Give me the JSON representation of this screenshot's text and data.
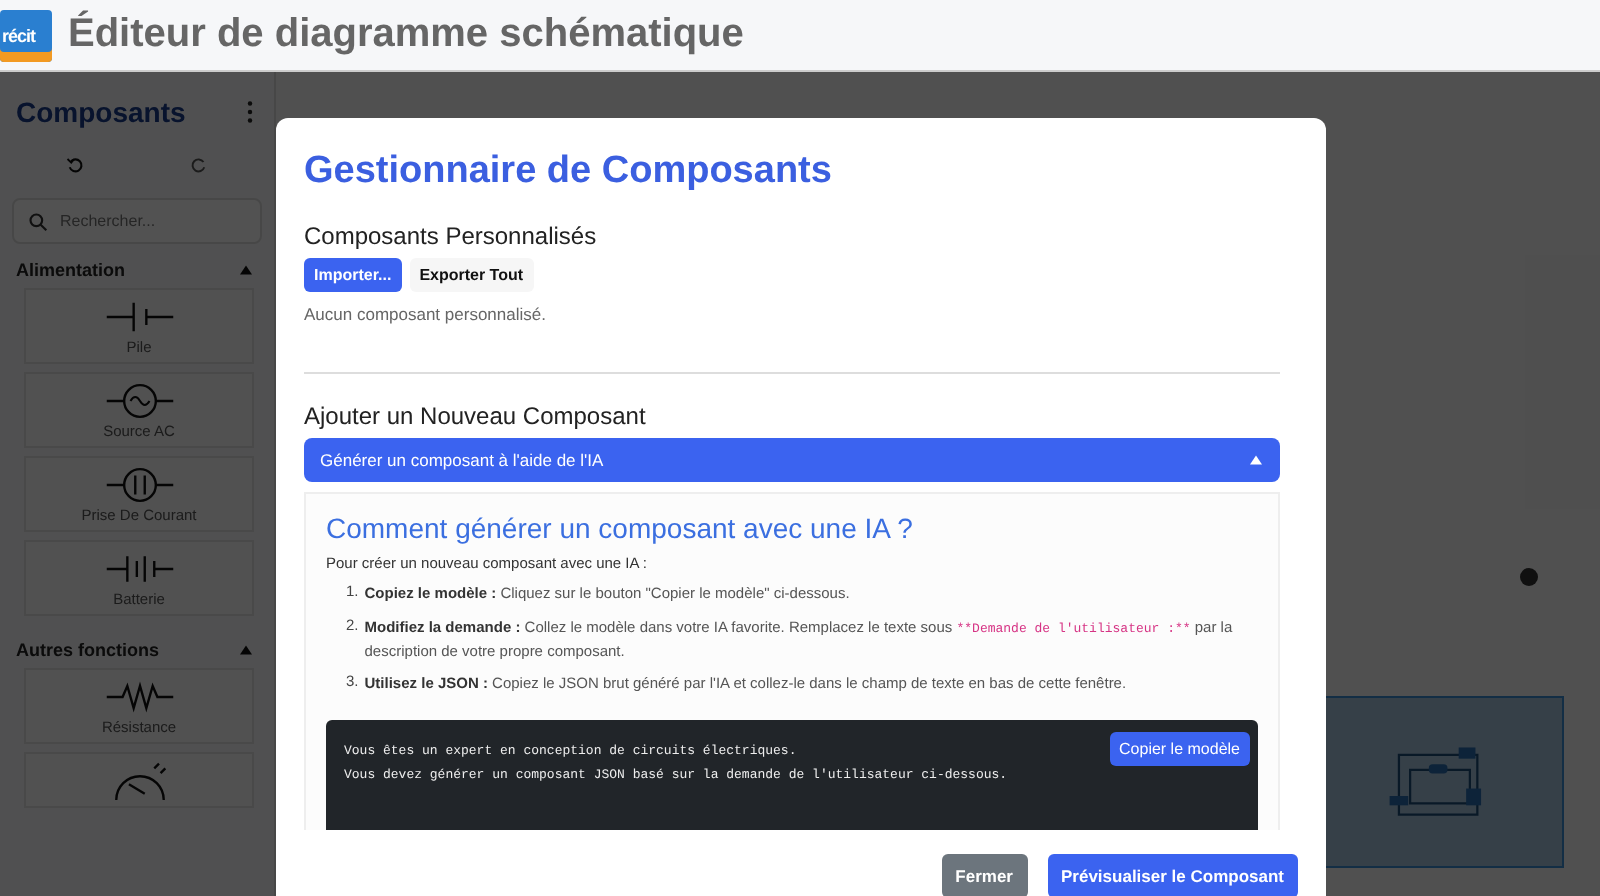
{
  "app": {
    "logo": "récit",
    "title": "Éditeur de diagramme schématique"
  },
  "sidebar": {
    "title": "Composants",
    "search": {
      "placeholder": "Rechercher..."
    },
    "sections": [
      {
        "title": "Alimentation",
        "expanded": true,
        "items": [
          {
            "kind": "cell",
            "label": "Pile"
          },
          {
            "kind": "ac-source",
            "label": "Source AC"
          },
          {
            "kind": "outlet",
            "label": "Prise De Courant"
          },
          {
            "kind": "battery",
            "label": "Batterie"
          }
        ]
      },
      {
        "title": "Autres fonctions",
        "expanded": true,
        "items": [
          {
            "kind": "resistor",
            "label": "Résistance"
          },
          {
            "kind": "meter"
          }
        ]
      }
    ]
  },
  "modal": {
    "title": "Gestionnaire de Composants",
    "custom": {
      "heading": "Composants Personnalisés",
      "buttons": [
        {
          "label": "Importer...",
          "kind": "primary"
        },
        {
          "label": "Exporter Tout",
          "kind": "light"
        }
      ],
      "empty": "Aucun composant personnalisé."
    },
    "add": {
      "heading": "Ajouter un Nouveau Composant",
      "accordion": {
        "label": "Générer un composant à l'aide de l'IA",
        "expanded": true
      },
      "help": {
        "heading": "Comment générer un composant avec une IA ?",
        "intro": "Pour créer un nouveau composant avec une IA :",
        "steps": [
          {
            "number": "1.",
            "lead": "Copiez le modèle :",
            "text": "Cliquez sur le bouton \"Copier le modèle\" ci-dessous."
          },
          {
            "number": "2.",
            "lead": "Modifiez la demande :",
            "text": "Collez le modèle dans votre IA favorite. Remplacez le texte sous",
            "code": "**Demande de l'utilisateur :**",
            "after": "par la description de votre propre composant."
          },
          {
            "number": "3.",
            "lead": "Utilisez le JSON :",
            "text": "Copiez le JSON brut généré par l'IA et collez-le dans le champ de texte en bas de cette fenêtre."
          }
        ],
        "template": {
          "lines": [
            "Vous êtes un expert en conception de circuits électriques.",
            "Vous devez générer un composant JSON basé sur la demande de l'utilisateur ci-dessous."
          ],
          "copy_button": "Copier le modèle"
        }
      }
    },
    "footer": [
      {
        "label": "Fermer",
        "kind": "secondary"
      },
      {
        "label": "Prévisualiser le Composant",
        "kind": "primary"
      }
    ]
  }
}
